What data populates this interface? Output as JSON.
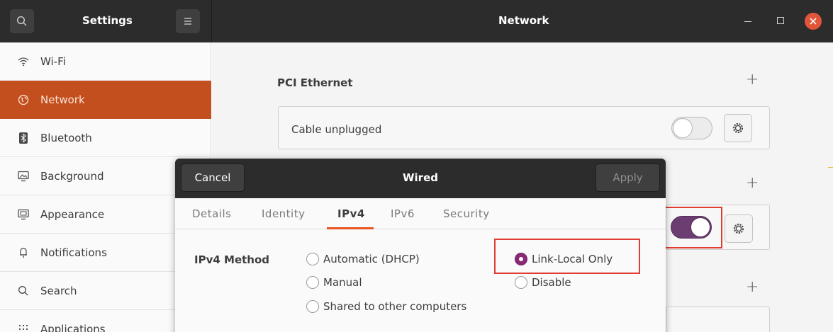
{
  "header": {
    "sidebar_title": "Settings",
    "main_title": "Network",
    "search_icon": "search-icon",
    "menu_icon": "hamburger-menu-icon",
    "window_controls": [
      "minimize-icon",
      "maximize-icon",
      "close-icon"
    ]
  },
  "sidebar": {
    "items": [
      {
        "label": "Wi-Fi",
        "icon": "wifi-icon"
      },
      {
        "label": "Network",
        "icon": "network-globe-icon",
        "active": true
      },
      {
        "label": "Bluetooth",
        "icon": "bluetooth-icon"
      },
      {
        "label": "Background",
        "icon": "background-icon"
      },
      {
        "label": "Appearance",
        "icon": "appearance-icon"
      },
      {
        "label": "Notifications",
        "icon": "bell-icon"
      },
      {
        "label": "Search",
        "icon": "search-icon"
      },
      {
        "label": "Applications",
        "icon": "apps-grid-icon"
      }
    ]
  },
  "main": {
    "pci_ethernet": {
      "title": "PCI Ethernet",
      "status": "Cable unplugged",
      "switch_on": false
    },
    "second_connection": {
      "switch_on": true
    }
  },
  "dialog": {
    "title": "Wired",
    "cancel_label": "Cancel",
    "apply_label": "Apply",
    "tabs": [
      "Details",
      "Identity",
      "IPv4",
      "IPv6",
      "Security"
    ],
    "active_tab": "IPv4",
    "ipv4_method_label": "IPv4 Method",
    "methods": {
      "automatic": "Automatic (DHCP)",
      "manual": "Manual",
      "shared": "Shared to other computers",
      "link_local": "Link-Local Only",
      "disable": "Disable"
    },
    "selected_method": "Link-Local Only"
  },
  "colors": {
    "accent": "#e95420",
    "sidebar_active": "#c44f1e",
    "switch_on": "#6b3d70",
    "radio_checked": "#8a2a74",
    "annotation": "#e03c31"
  }
}
